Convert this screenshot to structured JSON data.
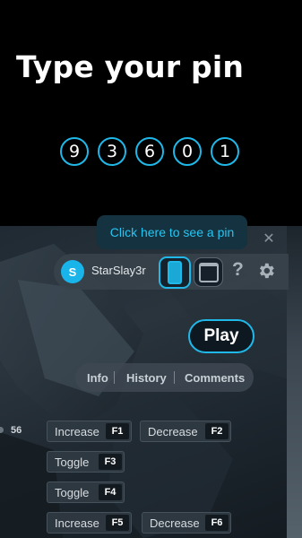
{
  "header": {
    "title": "Type your pin"
  },
  "pin": {
    "digits": [
      "9",
      "3",
      "6",
      "0",
      "1"
    ]
  },
  "tooltip": {
    "text": "Click here to see a pin"
  },
  "toolbar": {
    "avatar_initial": "S",
    "username": "StarSlay3r",
    "help_glyph": "?"
  },
  "play": {
    "label": "Play"
  },
  "tabs": [
    {
      "label": "Info"
    },
    {
      "label": "History"
    },
    {
      "label": "Comments"
    }
  ],
  "hud": {
    "value": "56"
  },
  "controls": [
    {
      "label": "Increase",
      "key": "F1"
    },
    {
      "label": "Decrease",
      "key": "F2"
    },
    {
      "label": "Toggle",
      "key": "F3"
    },
    {
      "label": "Toggle",
      "key": "F4"
    },
    {
      "label": "Increase",
      "key": "F5"
    },
    {
      "label": "Decrease",
      "key": "F6"
    }
  ],
  "colors": {
    "accent": "#1fb8e8",
    "background": "#000000",
    "panel": "#2a343d"
  },
  "icons": {
    "close": "close-icon",
    "phone": "phone-icon",
    "window": "window-icon",
    "help": "help-icon",
    "settings": "gear-icon"
  }
}
